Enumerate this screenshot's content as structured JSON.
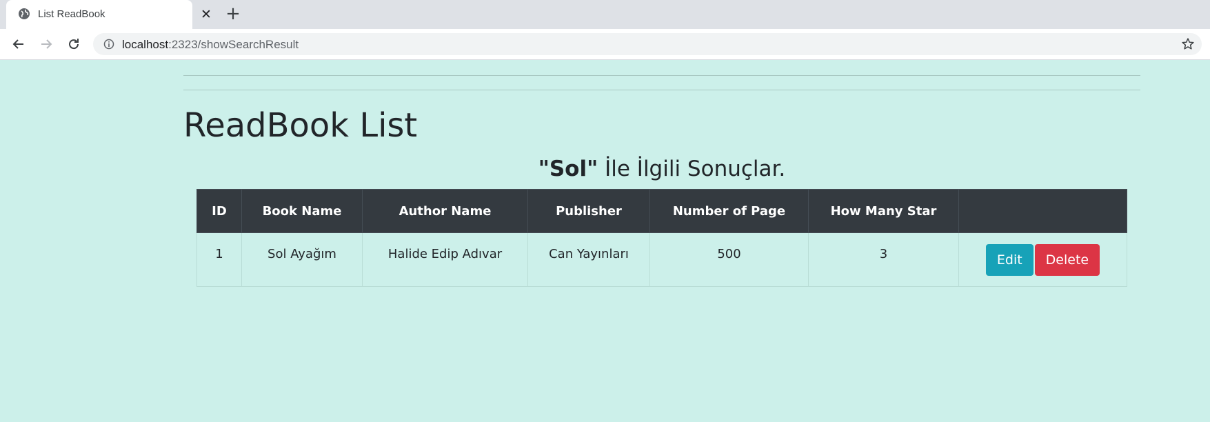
{
  "browser": {
    "tab_title": "List ReadBook",
    "url_host": "localhost",
    "url_path": ":2323/showSearchResult"
  },
  "page": {
    "title": "ReadBook List",
    "search_term": "\"Sol\"",
    "search_suffix": " İle İlgili Sonuçlar."
  },
  "table": {
    "headers": [
      "ID",
      "Book Name",
      "Author Name",
      "Publisher",
      "Number of Page",
      "How Many Star",
      ""
    ],
    "rows": [
      {
        "id": "1",
        "book_name": "Sol Ayağım",
        "author_name": "Halide Edip Adıvar",
        "publisher": "Can Yayınları",
        "pages": "500",
        "stars": "3"
      }
    ],
    "edit_label": "Edit",
    "delete_label": "Delete"
  },
  "colors": {
    "page_background": "#ccf0ea",
    "table_header": "#343a40",
    "edit_button": "#17a2b8",
    "delete_button": "#dc3545"
  }
}
